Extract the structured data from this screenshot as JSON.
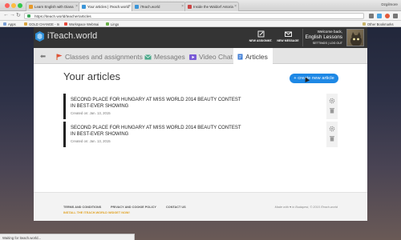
{
  "browser": {
    "tabs": [
      {
        "label": "Learn English with Diana",
        "active": false
      },
      {
        "label": "Your articles | iTeach.world",
        "active": true
      },
      {
        "label": "iTeach.world",
        "active": false
      },
      {
        "label": "Inside the Waldorf Astoria",
        "active": false
      }
    ],
    "user_name": "Dzgilmore",
    "url": "https://iteach.world/teacher/articles",
    "bookmarks": [
      "Apps",
      "GOLD CHANGE - In",
      "Workspace Webmai",
      "Lingo"
    ],
    "other_bookmarks": "Other Bookmarks",
    "status_text": "Waiting for iteach.world..."
  },
  "site": {
    "logo_text": "iTeach.world",
    "header_actions": {
      "new_assignment": "NEW ASSIGNMT.",
      "new_message": "NEW MESSAGE"
    },
    "welcome": {
      "greeting": "Welcome back,",
      "name": "English Lessons",
      "settings": "SETTINGS",
      "separator": "|",
      "logout": "LOG OUT"
    },
    "nav": {
      "back_glyph": "⬅",
      "tabs": [
        {
          "label": "Classes and assignments",
          "icon": "flag-icon",
          "active": false
        },
        {
          "label": "Messages",
          "icon": "mail-icon",
          "active": false
        },
        {
          "label": "Video Chat",
          "icon": "video-icon",
          "active": false
        },
        {
          "label": "Articles",
          "icon": "document-icon",
          "active": true
        }
      ]
    },
    "page_title": "Your articles",
    "create_button": "+ create new article",
    "articles": [
      {
        "title": "SECOND PLACE FOR HUNGARY AT MISS WORLD 2014 BEAUTY CONTEST IN BEST-EVER SHOWING",
        "created": "Created on: Jan. 13, 2015"
      },
      {
        "title": "SECOND PLACE FOR HUNGARY AT MISS WORLD 2014 BEAUTY CONTEST IN BEST-EVER SHOWING",
        "created": "Created on: Jan. 13, 2015"
      }
    ],
    "footer": {
      "links": [
        "TERMS AND CONDITIONS",
        "PRIVACY AND COOKIE POLICY",
        "CONTACT US"
      ],
      "widget": "INSTALL THE ITEACH.WORLD WIDGET NOW!",
      "made": "Made with ♥ in Budapest, © 2015 iTeach.world"
    }
  },
  "colors": {
    "accent": "#1e88e5",
    "header_bg": "#343434",
    "widget_link": "#e0a020"
  }
}
